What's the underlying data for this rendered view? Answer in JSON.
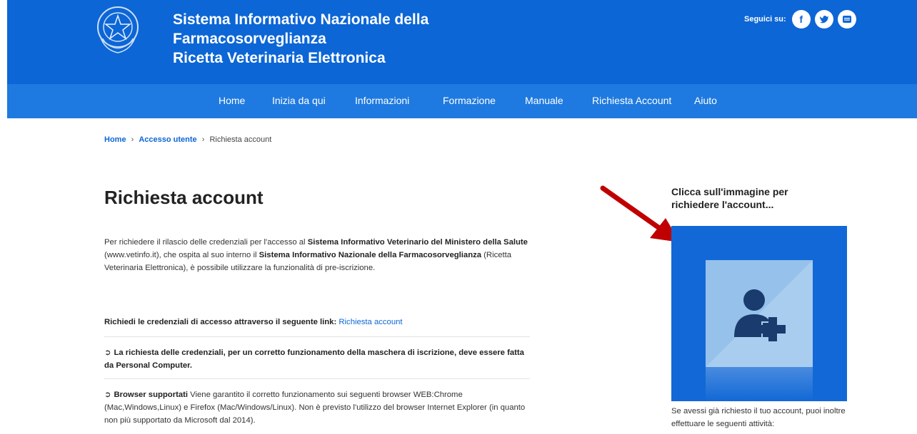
{
  "header": {
    "title_line1": "Sistema Informativo Nazionale della",
    "title_line2": "Farmacosorveglianza",
    "title_line3": "Ricetta Veterinaria Elettronica",
    "social_label": "Seguici su:",
    "social_icons": [
      "facebook-icon",
      "twitter-icon",
      "youtube-icon"
    ]
  },
  "nav": {
    "items": [
      "Home",
      "Inizia da qui",
      "Informazioni",
      "Formazione",
      "Manuale",
      "Richiesta Account",
      "Aiuto"
    ]
  },
  "breadcrumb": {
    "home": "Home",
    "sep": "›",
    "accesso": "Accesso utente",
    "current": "Richiesta account"
  },
  "main": {
    "title": "Richiesta account",
    "intro": {
      "p1": "Per richiedere il rilascio delle credenziali per l'accesso al ",
      "b1": "Sistema Informativo Veterinario del Ministero della Salute",
      "p2": " (www.vetinfo.it), che ospita al suo interno il ",
      "b2": "Sistema Informativo Nazionale della Farmacosorveglianza",
      "p3": " (Ricetta Veterinaria Elettronica), è possibile utilizzare la funzionalità di pre-iscrizione."
    },
    "link_row": {
      "label": "Richiedi le credenziali di accesso attraverso il seguente link:",
      "link_text": "Richiesta account"
    },
    "note1": "La richiesta delle credenziali, per un corretto funzionamento della maschera di iscrizione, deve essere fatta da Personal Computer.",
    "note2": {
      "bold": "Browser supportati",
      "text": " Viene garantito il corretto funzionamento sui seguenti browser WEB:Chrome (Mac,Windows,Linux) e Firefox (Mac/Windows/Linux). Non è previsto l'utilizzo del browser Internet Explorer (in quanto non più supportato da Microsoft dal 2014)."
    },
    "bullet_icon": "circle-arrow-right-icon"
  },
  "sidebar": {
    "title": "Clicca sull'immagine per richiedere l'account...",
    "image_icon": "add-user-icon",
    "note": "Se avessi già richiesto il tuo account, puoi inoltre effettuare le seguenti attività:"
  },
  "colors": {
    "header": "#0c66d6",
    "nav": "#1e7ae0",
    "link": "#0c66d6",
    "arrow": "#c00000"
  }
}
